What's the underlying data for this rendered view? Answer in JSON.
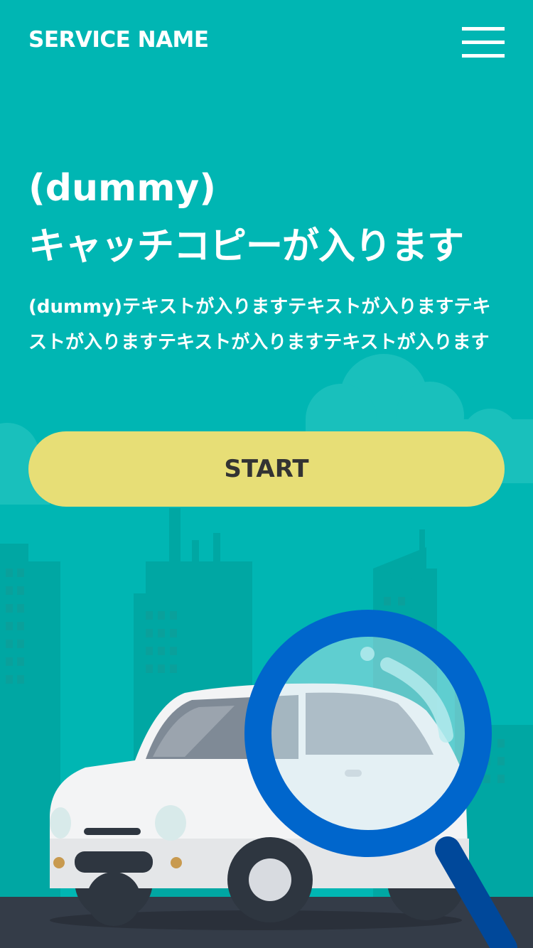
{
  "header": {
    "service_name": "SERVICE NAME",
    "menu_icon": "hamburger-menu-icon"
  },
  "hero": {
    "subtitle": "(dummy)",
    "title": "キャッチコピーが入ります",
    "description": "(dummy)テキストが入りますテキストが入りますテキストが入りますテキストが入りますテキストが入ります"
  },
  "cta": {
    "label": "START"
  },
  "colors": {
    "background": "#00b6b3",
    "button": "#e7de76",
    "button_text": "#333333",
    "magnifier": "#0066cc",
    "road": "#343c48"
  },
  "illustration": {
    "subject": "car-with-magnifying-glass-illustration"
  }
}
